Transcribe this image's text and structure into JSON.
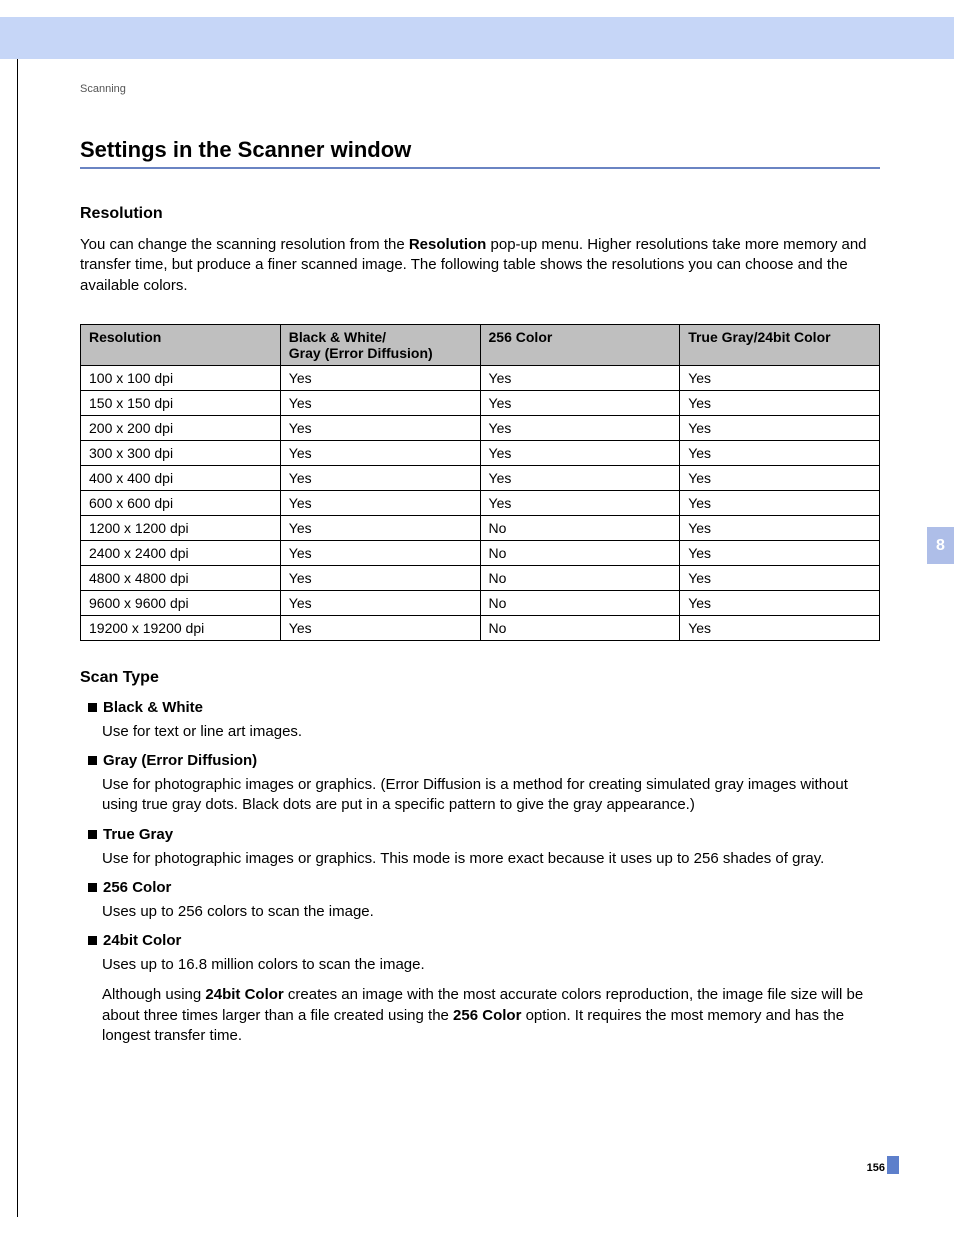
{
  "breadcrumb": "Scanning",
  "h1": "Settings in the Scanner window",
  "resolution": {
    "heading": "Resolution",
    "para_pre": "You can change the scanning resolution from the ",
    "para_bold": "Resolution",
    "para_post": " pop-up menu. Higher resolutions take more memory and transfer time, but produce a finer scanned image. The following table shows the resolutions you can choose and the available colors."
  },
  "table": {
    "headers": {
      "c0": "Resolution",
      "c1a": "Black & White/",
      "c1b": "Gray (Error Diffusion)",
      "c2": "256 Color",
      "c3": "True Gray/24bit Color"
    },
    "rows": [
      {
        "c0": "100 x 100 dpi",
        "c1": "Yes",
        "c2": "Yes",
        "c3": "Yes"
      },
      {
        "c0": "150 x 150 dpi",
        "c1": "Yes",
        "c2": "Yes",
        "c3": "Yes"
      },
      {
        "c0": "200 x 200 dpi",
        "c1": "Yes",
        "c2": "Yes",
        "c3": "Yes"
      },
      {
        "c0": "300 x 300 dpi",
        "c1": "Yes",
        "c2": "Yes",
        "c3": "Yes"
      },
      {
        "c0": "400 x 400 dpi",
        "c1": "Yes",
        "c2": "Yes",
        "c3": "Yes"
      },
      {
        "c0": "600 x 600 dpi",
        "c1": "Yes",
        "c2": "Yes",
        "c3": "Yes"
      },
      {
        "c0": "1200 x 1200 dpi",
        "c1": "Yes",
        "c2": "No",
        "c3": "Yes"
      },
      {
        "c0": "2400 x 2400 dpi",
        "c1": "Yes",
        "c2": "No",
        "c3": "Yes"
      },
      {
        "c0": "4800 x 4800 dpi",
        "c1": "Yes",
        "c2": "No",
        "c3": "Yes"
      },
      {
        "c0": "9600 x 9600 dpi",
        "c1": "Yes",
        "c2": "No",
        "c3": "Yes"
      },
      {
        "c0": "19200 x 19200 dpi",
        "c1": "Yes",
        "c2": "No",
        "c3": "Yes"
      }
    ]
  },
  "scan_type": {
    "heading": "Scan Type",
    "items": [
      {
        "title": "Black & White",
        "desc1": "Use for text or line art images."
      },
      {
        "title": "Gray (Error Diffusion)",
        "desc1": "Use for photographic images or graphics. (Error Diffusion is a method for creating simulated gray images without using true gray dots. Black dots are put in a specific pattern to give the gray appearance.)"
      },
      {
        "title": "True Gray",
        "desc1": "Use for photographic images or graphics. This mode is more exact because it uses up to 256 shades of gray."
      },
      {
        "title": "256 Color",
        "desc1": "Uses up to 256 colors to scan the image."
      },
      {
        "title": "24bit Color",
        "desc1": "Uses up to 16.8 million colors to scan the image.",
        "desc2_pre": "Although using ",
        "desc2_b1": "24bit Color",
        "desc2_mid": " creates an image with the most accurate colors reproduction, the image file size will be about three times larger than a file created using the ",
        "desc2_b2": "256 Color",
        "desc2_post": " option. It requires the most memory and has the longest transfer time."
      }
    ]
  },
  "side_tab": "8",
  "page_number": "156"
}
